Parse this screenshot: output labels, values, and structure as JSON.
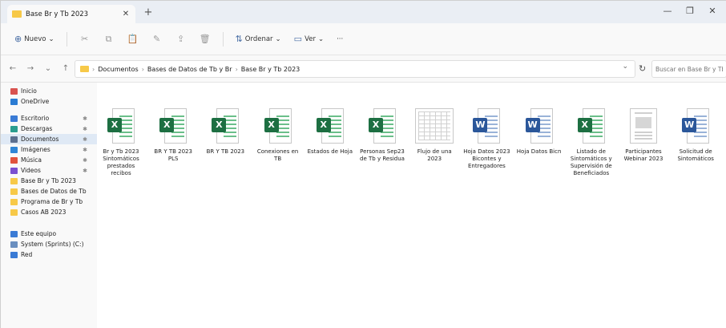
{
  "window": {
    "tab_title": "Base Br y Tb 2023",
    "tab_close": "✕",
    "new_tab": "+",
    "controls": [
      "—",
      "❐",
      "✕"
    ]
  },
  "toolbar": {
    "new_label": "Nuevo",
    "sort_label": "Ordenar",
    "view_label": "Ver",
    "more_label": "···",
    "icon_buttons": [
      "✂",
      "⧉",
      "📋",
      "✎",
      "⇪",
      "🗑"
    ]
  },
  "address": {
    "crumbs": [
      "Documentos",
      "Bases de Datos de Tb y Br",
      "Base Br y Tb 2023"
    ],
    "search_placeholder": "Buscar en Base Br y Tb 2023"
  },
  "sidebar": {
    "items": [
      {
        "label": "Inicio",
        "icon": "home-icon",
        "color": "#d9534f",
        "pinned": false
      },
      {
        "label": "OneDrive",
        "icon": "cloud-icon",
        "color": "#2b7cd3",
        "pinned": false
      },
      {
        "label": "Escritorio",
        "icon": "desktop-icon",
        "color": "#3a7bd5",
        "pinned": true
      },
      {
        "label": "Descargas",
        "icon": "download-icon",
        "color": "#2a9d8f",
        "pinned": true
      },
      {
        "label": "Documentos",
        "icon": "document-icon",
        "color": "#5b6f8f",
        "pinned": true,
        "selected": true
      },
      {
        "label": "Imágenes",
        "icon": "image-icon",
        "color": "#2f86d6",
        "pinned": true
      },
      {
        "label": "Música",
        "icon": "music-icon",
        "color": "#e0533d",
        "pinned": true
      },
      {
        "label": "Videos",
        "icon": "video-icon",
        "color": "#7a4fd0",
        "pinned": true
      },
      {
        "label": "Base Br y Tb 2023",
        "icon": "folder-icon",
        "color": "#f7c948",
        "pinned": false
      },
      {
        "label": "Bases de Datos de Tb",
        "icon": "folder-icon",
        "color": "#f7c948",
        "pinned": false
      },
      {
        "label": "Programa de Br y Tb",
        "icon": "folder-icon",
        "color": "#f7c948",
        "pinned": false
      },
      {
        "label": "Casos AB 2023",
        "icon": "folder-icon",
        "color": "#f7c948",
        "pinned": false
      }
    ],
    "lower_items": [
      {
        "label": "Este equipo",
        "icon": "computer-icon",
        "color": "#3a7bd5"
      },
      {
        "label": "System (Sprints) (C:)",
        "icon": "drive-icon",
        "color": "#6a8fbf"
      },
      {
        "label": "Red",
        "icon": "network-icon",
        "color": "#3a7bd5"
      }
    ],
    "pin_glyph": "✱"
  },
  "files": [
    {
      "name": "Br y Tb 2023 Sintomáticos prestados recibos",
      "type": "excel"
    },
    {
      "name": "BR Y TB 2023 PLS",
      "type": "excel"
    },
    {
      "name": "BR Y TB 2023",
      "type": "excel"
    },
    {
      "name": "Conexiones en TB",
      "type": "excel"
    },
    {
      "name": "Estados de Hoja",
      "type": "excel"
    },
    {
      "name": "Personas Sep23 de Tb y Residua",
      "type": "excel"
    },
    {
      "name": "Flujo de una 2023",
      "type": "sheet-thumb"
    },
    {
      "name": "Hoja Datos 2023 Bicontes y Entregadores",
      "type": "word"
    },
    {
      "name": "Hoja Datos Bicn",
      "type": "word"
    },
    {
      "name": "Listado de Sintomáticos y Supervisión de Beneficiados",
      "type": "excel"
    },
    {
      "name": "Participantes Webinar 2023",
      "type": "doc-thumb"
    },
    {
      "name": "Solicitud de Sintomáticos",
      "type": "word"
    }
  ],
  "colors": {
    "excel": "#1d6f42",
    "word": "#2b579a",
    "folder": "#f7c948",
    "selected": "#dfe9f5"
  }
}
